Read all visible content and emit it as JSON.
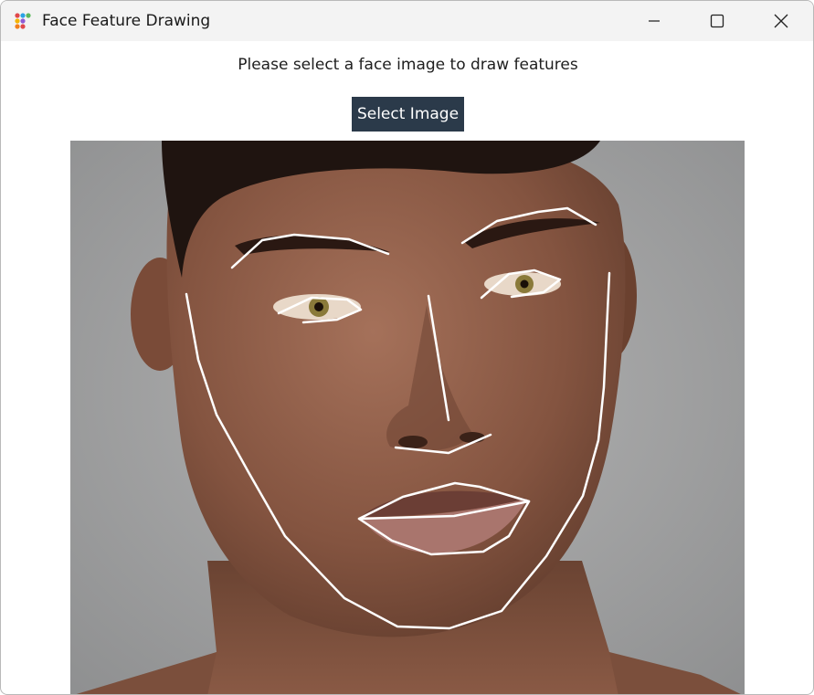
{
  "window": {
    "title": "Face Feature Drawing",
    "app_icon": "app-dots-icon",
    "controls": {
      "minimize": "minimize-icon",
      "maximize": "maximize-icon",
      "close": "close-icon"
    }
  },
  "main": {
    "prompt": "Please select a face image to draw features",
    "select_button_label": "Select Image"
  },
  "image": {
    "subject": "portrait photo of a man's face",
    "overlay_color": "#ffffff",
    "features": [
      "jaw",
      "left-eyebrow",
      "right-eyebrow",
      "left-eye",
      "right-eye",
      "nose",
      "mouth"
    ]
  },
  "colors": {
    "titlebar_bg": "#f3f3f3",
    "button_bg": "#2b3a4a",
    "button_text": "#ffffff",
    "photo_background": "#9a9b9c",
    "skin": "#8a5a44"
  }
}
